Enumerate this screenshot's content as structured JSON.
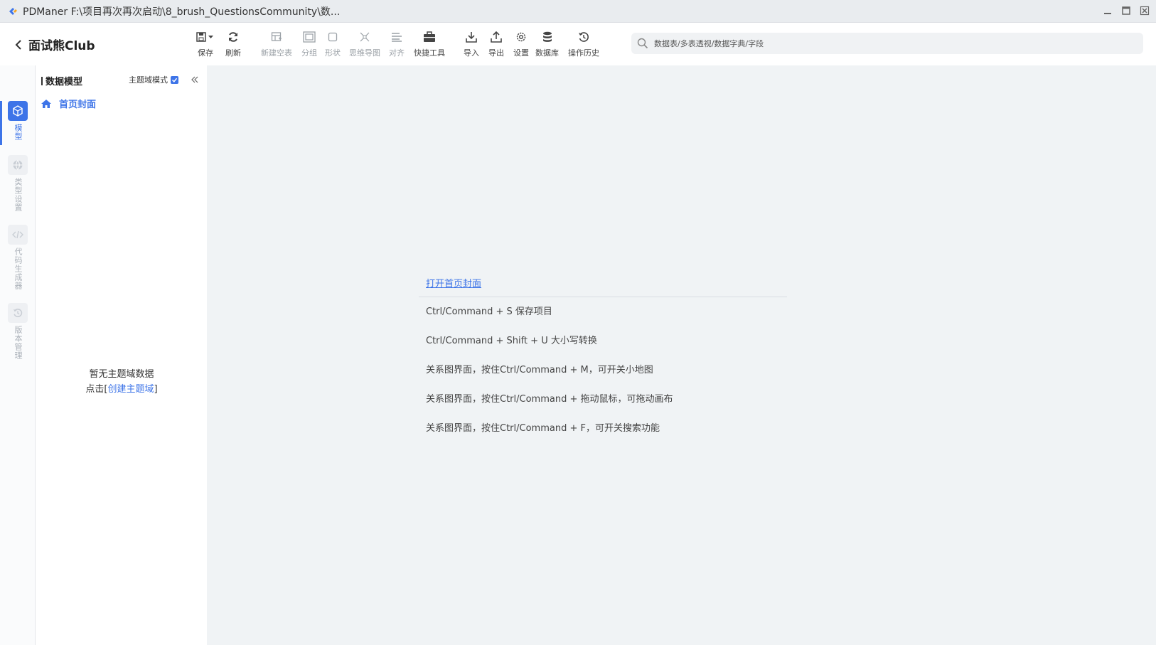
{
  "window": {
    "title": "PDManer  F:\\项目再次再次启动\\8_brush_QuestionsCommunity\\数..."
  },
  "header": {
    "project_name": "面试熊Club"
  },
  "toolbar": {
    "items": [
      {
        "label": "保存",
        "icon": "save-icon"
      },
      {
        "label": "刷新",
        "icon": "refresh-icon"
      },
      {
        "label": "新建空表",
        "icon": "new-table-icon"
      },
      {
        "label": "分组",
        "icon": "group-icon"
      },
      {
        "label": "形状",
        "icon": "shape-icon"
      },
      {
        "label": "思维导图",
        "icon": "mindmap-icon"
      },
      {
        "label": "对齐",
        "icon": "align-icon"
      },
      {
        "label": "快捷工具",
        "icon": "toolbox-icon"
      },
      {
        "label": "导入",
        "icon": "import-icon"
      },
      {
        "label": "导出",
        "icon": "export-icon"
      },
      {
        "label": "设置",
        "icon": "gear-icon"
      },
      {
        "label": "数据库",
        "icon": "database-icon"
      },
      {
        "label": "操作历史",
        "icon": "history-icon"
      }
    ]
  },
  "search": {
    "placeholder": "数据表/多表透视/数据字典/字段"
  },
  "rail": {
    "items": [
      {
        "label": "模型",
        "icon": "cube-icon",
        "active": true
      },
      {
        "label": "类型设置",
        "icon": "globe-icon",
        "active": false
      },
      {
        "label": "代码生成器",
        "icon": "code-icon",
        "active": false
      },
      {
        "label": "版本管理",
        "icon": "version-icon",
        "active": false
      }
    ]
  },
  "panel": {
    "title": "数据模型",
    "mode_label": "主题域模式",
    "home_label": "首页封面",
    "empty_text": "暂无主题域数据",
    "empty_prefix": "点击[",
    "empty_link": "创建主题域",
    "empty_suffix": "]"
  },
  "cover": {
    "open_link": "打开首页封面",
    "tips": [
      "Ctrl/Command + S 保存项目",
      "Ctrl/Command + Shift + U 大小写转换",
      "关系图界面，按住Ctrl/Command + M，可开关小地图",
      "关系图界面，按住Ctrl/Command + 拖动鼠标，可拖动画布",
      "关系图界面，按住Ctrl/Command + F，可开关搜索功能"
    ]
  },
  "colors": {
    "accent": "#3d74e8",
    "main_bg": "#f0f3f5"
  }
}
